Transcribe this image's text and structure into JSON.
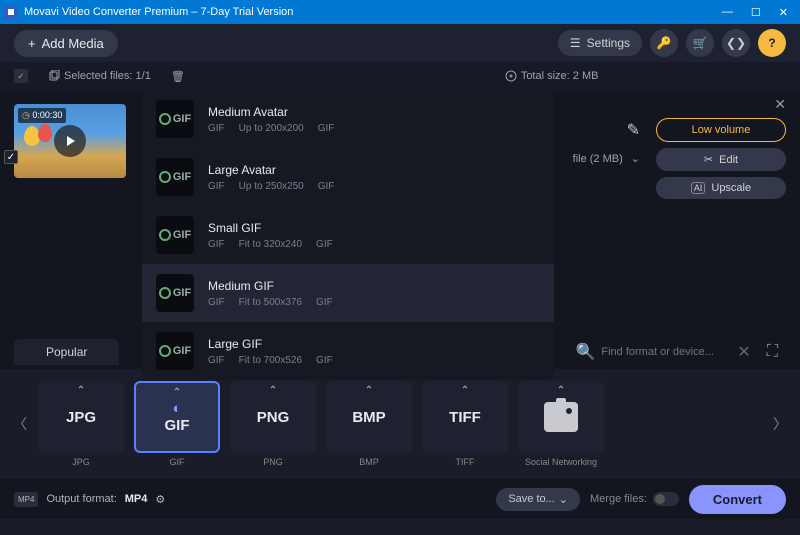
{
  "titlebar": {
    "title": "Movavi Video Converter Premium – 7-Day Trial Version"
  },
  "toolbar": {
    "add_media": "Add Media",
    "settings": "Settings"
  },
  "infobar": {
    "selected": "Selected files: 1/1",
    "total_size": "Total size: 2 MB"
  },
  "thumb": {
    "time": "0:00:30"
  },
  "compress": {
    "text": "file (2 MB)"
  },
  "right": {
    "low_volume": "Low volume",
    "edit": "Edit",
    "upscale": "Upscale"
  },
  "dropdown": [
    {
      "title": "Medium Avatar",
      "fmt": "GIF",
      "dim": "Up to 200x200",
      "fmt2": "GIF"
    },
    {
      "title": "Large Avatar",
      "fmt": "GIF",
      "dim": "Up to 250x250",
      "fmt2": "GIF"
    },
    {
      "title": "Small GIF",
      "fmt": "GIF",
      "dim": "Fit to 320x240",
      "fmt2": "GIF"
    },
    {
      "title": "Medium GIF",
      "fmt": "GIF",
      "dim": "Fit to 500x376",
      "fmt2": "GIF"
    },
    {
      "title": "Large GIF",
      "fmt": "GIF",
      "dim": "Fit to 700x526",
      "fmt2": "GIF"
    }
  ],
  "tabs": {
    "popular": "Popular",
    "search_placeholder": "Find format or device..."
  },
  "formats": [
    {
      "big": "JPG",
      "label": "JPG"
    },
    {
      "big": "GIF",
      "label": "GIF"
    },
    {
      "big": "PNG",
      "label": "PNG"
    },
    {
      "big": "BMP",
      "label": "BMP"
    },
    {
      "big": "TIFF",
      "label": "TIFF"
    },
    {
      "big": "",
      "label": "Social Networking"
    }
  ],
  "bottom": {
    "output_label": "Output format:",
    "output_value": "MP4",
    "save_to": "Save to...",
    "merge": "Merge files:",
    "convert": "Convert"
  }
}
